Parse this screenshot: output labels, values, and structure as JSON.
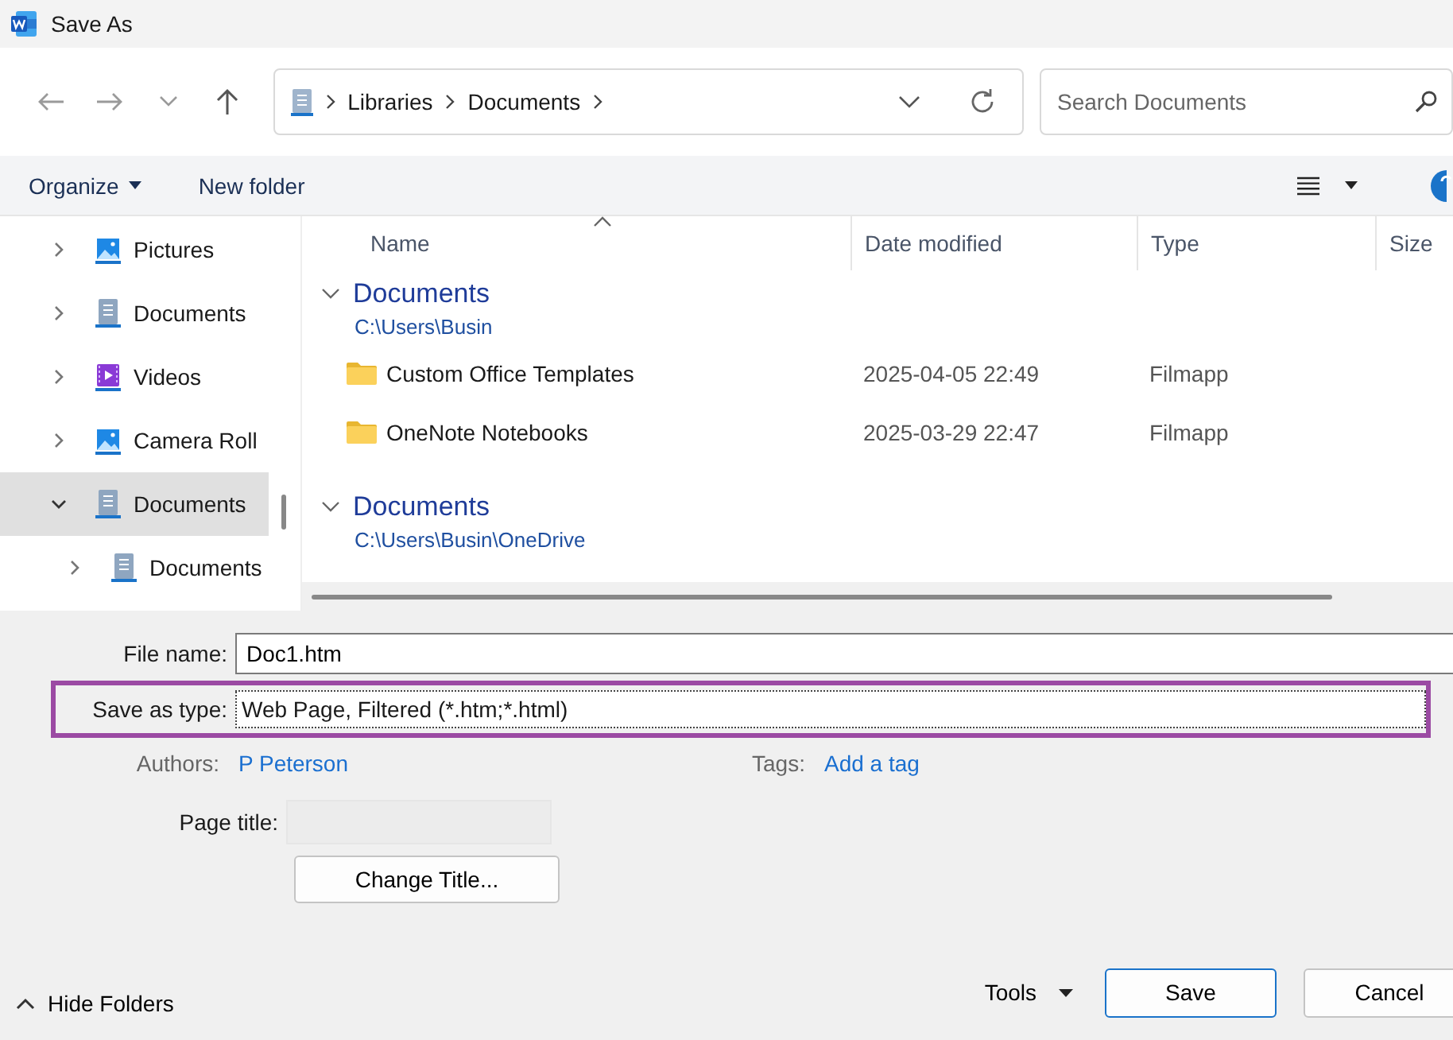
{
  "window": {
    "title": "Save As"
  },
  "nav": {
    "breadcrumb": [
      "Libraries",
      "Documents"
    ],
    "search": {
      "placeholder": "Search Documents"
    }
  },
  "toolbar": {
    "organize": "Organize",
    "new_folder": "New folder"
  },
  "sidebar": {
    "items": [
      {
        "label": "Pictures",
        "kind": "picture",
        "expanded": false,
        "selected": false
      },
      {
        "label": "Documents",
        "kind": "document",
        "expanded": false,
        "selected": false
      },
      {
        "label": "Videos",
        "kind": "video",
        "expanded": false,
        "selected": false
      },
      {
        "label": "Camera Roll",
        "kind": "picture",
        "expanded": false,
        "selected": false
      },
      {
        "label": "Documents",
        "kind": "document",
        "expanded": true,
        "selected": true,
        "children": [
          {
            "label": "Documents",
            "kind": "document",
            "expanded": false,
            "selected": false
          }
        ]
      }
    ]
  },
  "file_list": {
    "columns": [
      "Name",
      "Date modified",
      "Type",
      "Size"
    ],
    "groups": [
      {
        "title": "Documents",
        "path": "C:\\Users\\Busin",
        "expanded": true,
        "rows": [
          {
            "name": "Custom Office Templates",
            "date_modified": "2025-04-05 22:49",
            "type": "Filmapp"
          },
          {
            "name": "OneNote Notebooks",
            "date_modified": "2025-03-29 22:47",
            "type": "Filmapp"
          }
        ]
      },
      {
        "title": "Documents",
        "path": "C:\\Users\\Busin\\OneDrive",
        "expanded": true
      }
    ]
  },
  "form": {
    "file_name": {
      "label": "File name:",
      "value": "Doc1.htm"
    },
    "save_as_type": {
      "label": "Save as type:",
      "value": "Web Page, Filtered (*.htm;*.html)",
      "highlighted": true
    },
    "authors": {
      "label": "Authors:",
      "value": "P Peterson"
    },
    "tags": {
      "label": "Tags:",
      "value": "Add a tag"
    },
    "page_title": {
      "label": "Page title:"
    },
    "change_title": "Change Title..."
  },
  "footer": {
    "hide_folders": "Hide Folders",
    "tools": "Tools",
    "buttons": [
      {
        "label": "Save",
        "default": true
      },
      {
        "label": "Cancel",
        "default": false
      }
    ]
  }
}
